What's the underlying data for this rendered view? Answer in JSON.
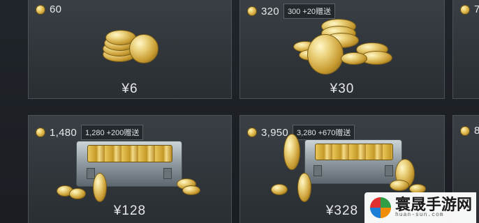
{
  "currency_symbol": "¥",
  "packages": [
    {
      "amount": "60",
      "bonus": "",
      "price": "¥6"
    },
    {
      "amount": "320",
      "bonus": "300 +20赠送",
      "price": "¥30"
    },
    {
      "amount": "1,480",
      "bonus": "1,280 +200赠送",
      "price": "¥128"
    },
    {
      "amount": "3,950",
      "bonus": "3,280 +670赠送",
      "price": "¥328"
    }
  ],
  "partial_cards": [
    {
      "amount": "7"
    },
    {
      "amount": "8"
    }
  ],
  "watermark": {
    "title": "寰晟手游网",
    "subtitle": "huan-sun.com"
  },
  "colors": {
    "background": "#1b1f24",
    "card": "#33383e",
    "text": "#e6e8ea",
    "gold": "#e0b64a"
  },
  "icons": {
    "currency": "gold-coin-icon"
  }
}
